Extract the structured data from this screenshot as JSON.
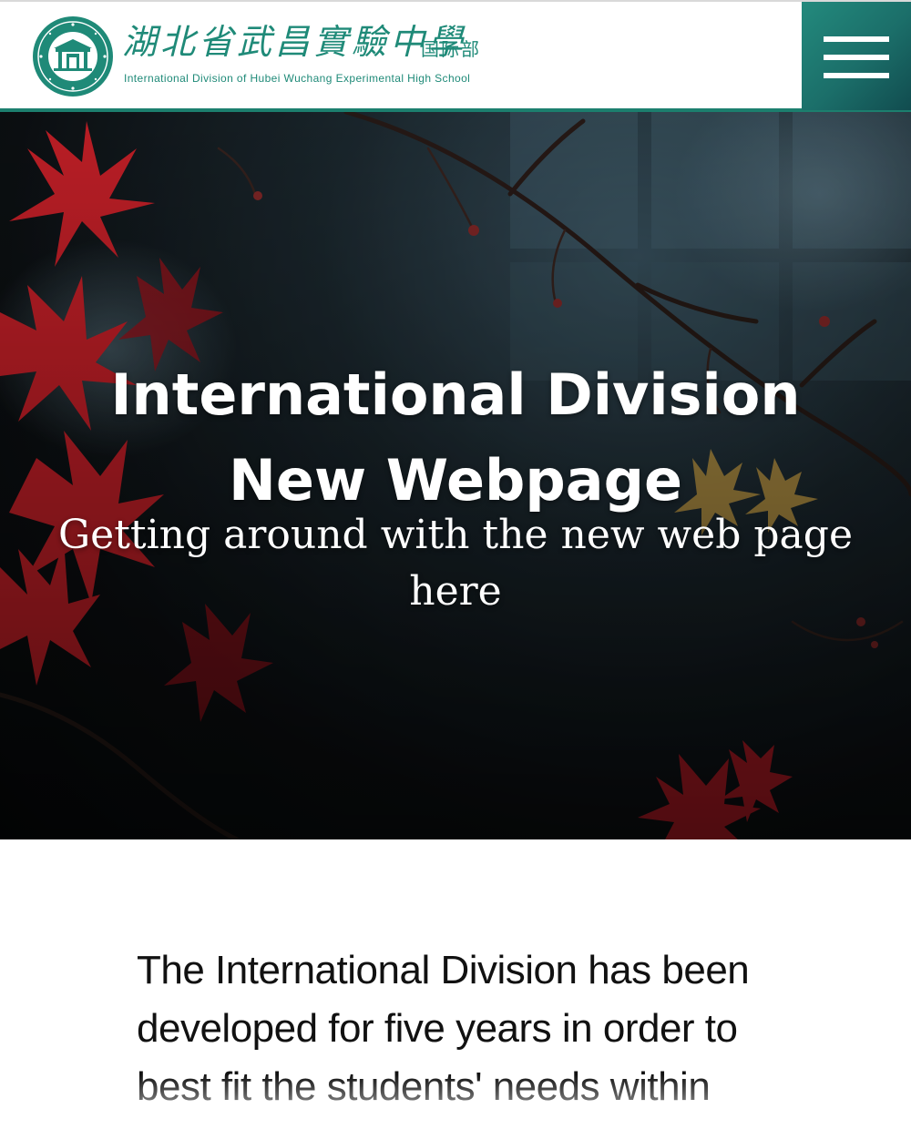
{
  "header": {
    "logo_cn": "湖北省武昌實驗中學",
    "logo_cn_suffix": "国际部",
    "logo_en": "International Division of Hubei Wuchang Experimental High School",
    "brand_color": "#1f8a78",
    "menu_icon": "hamburger-icon"
  },
  "hero": {
    "title": "International Division New Webpage",
    "subtitle": "Getting around with the new web page here"
  },
  "intro": {
    "text": "The International Division has been developed for five years in order to best fit the students' needs within our academic"
  }
}
